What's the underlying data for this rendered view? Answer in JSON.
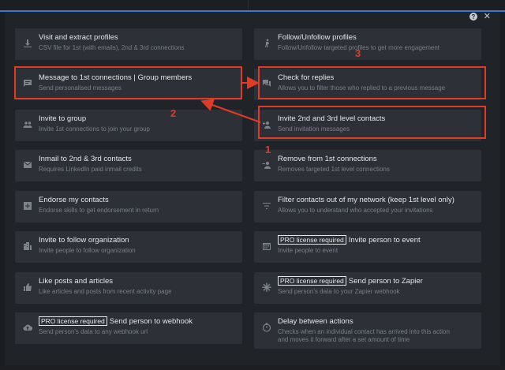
{
  "window": {
    "help_icon": "?",
    "close_icon": "✕"
  },
  "actions": [
    {
      "title": "Visit and extract profiles",
      "desc": "CSV file for 1st (with emails), 2nd & 3rd connections",
      "icon": "download-icon"
    },
    {
      "title": "Follow/Unfollow profiles",
      "desc": "Follow/Unfollow targeted profiles to get more engagement",
      "icon": "running-person-icon"
    },
    {
      "title": "Message to 1st connections | Group members",
      "desc": "Send personalised messages",
      "icon": "message-icon"
    },
    {
      "title": "Check for replies",
      "desc": "Allows you to filter those who replied to a previous message",
      "icon": "chat-icon"
    },
    {
      "title": "Invite to group",
      "desc": "Invite 1st connections to join your group",
      "icon": "group-icon"
    },
    {
      "title": "Invite 2nd and 3rd level contacts",
      "desc": "Send invitation messages",
      "icon": "add-person-icon"
    },
    {
      "title": "Inmail to 2nd & 3rd contacts",
      "desc": "Requires LinkedIn paid inmail credits",
      "icon": "mail-icon"
    },
    {
      "title": "Remove from 1st connections",
      "desc": "Removes targeted 1st level connections",
      "icon": "remove-person-icon"
    },
    {
      "title": "Endorse my contacts",
      "desc": "Endorse skills to get endorsement in return",
      "icon": "plus-box-icon"
    },
    {
      "title": "Filter contacts out of my network (keep 1st level only)",
      "desc": "Allows you to understand who accepted your invitations",
      "icon": "filter-icon"
    },
    {
      "title": "Invite to follow organization",
      "desc": "Invite people to follow organization",
      "icon": "building-icon"
    },
    {
      "title": "Invite person to event",
      "desc": "Invite people to event",
      "icon": "calendar-icon",
      "pro": "PRO license required"
    },
    {
      "title": "Like posts and articles",
      "desc": "Like articles and posts from recent activity page",
      "icon": "thumbs-up-icon"
    },
    {
      "title": "Send person to Zapier",
      "desc": "Send person's data to your Zapier webhook",
      "icon": "zapier-icon",
      "pro": "PRO license required"
    },
    {
      "title": "Send person to webhook",
      "desc": "Send person's data to any webhook url",
      "icon": "cloud-upload-icon",
      "pro": "PRO license required"
    },
    {
      "title": "Delay between actions",
      "desc": "Checks when an individual contact has arrived into this action",
      "desc2": "and moves it forward after a set amount of time",
      "icon": "timer-icon"
    }
  ],
  "annotations": {
    "n1": "1",
    "n2": "2",
    "n3": "3"
  },
  "colors": {
    "highlight": "#e23b25",
    "card": "#2d3036",
    "accent": "#3a7bd5"
  }
}
